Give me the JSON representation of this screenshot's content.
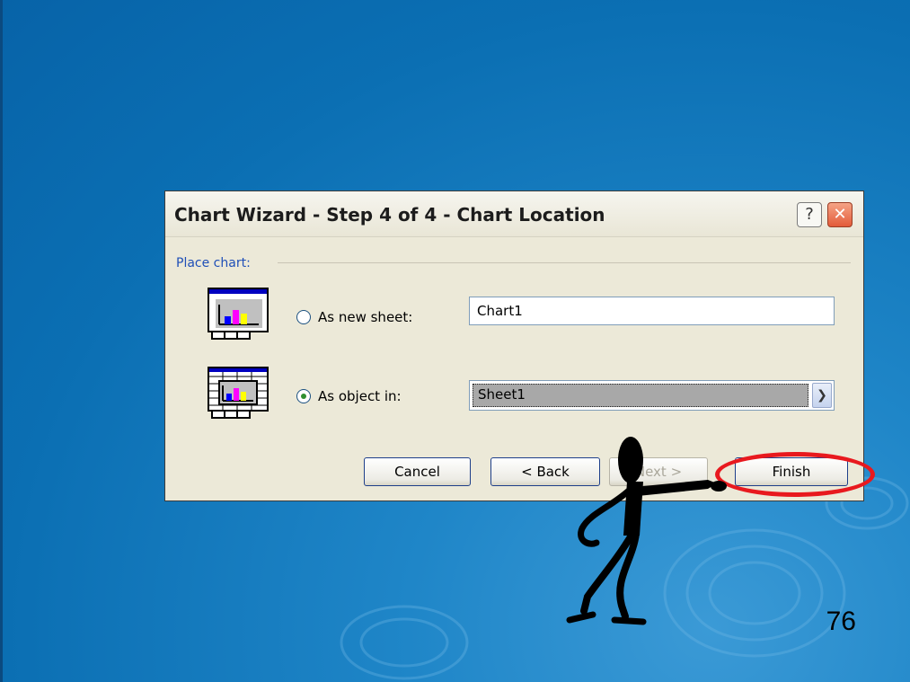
{
  "dialog": {
    "title": "Chart Wizard - Step 4 of 4 - Chart Location",
    "help_label": "?",
    "close_label": "✕",
    "group_label": "Place chart:",
    "option_new_sheet": {
      "label": "As new sheet:",
      "checked": false,
      "value": "Chart1"
    },
    "option_object_in": {
      "label": "As object in:",
      "checked": true,
      "value": "Sheet1"
    },
    "buttons": {
      "cancel": "Cancel",
      "back": "< Back",
      "next": "Next >",
      "finish": "Finish"
    }
  },
  "slide": {
    "page_number": "76"
  },
  "colors": {
    "background": "#0b6fb3",
    "highlight": "#e8191e",
    "group_label": "#1f4fb7"
  },
  "icons": [
    "chart-sheet-icon",
    "chart-object-icon",
    "chevron-down-icon",
    "stickman-pointing-figure"
  ]
}
